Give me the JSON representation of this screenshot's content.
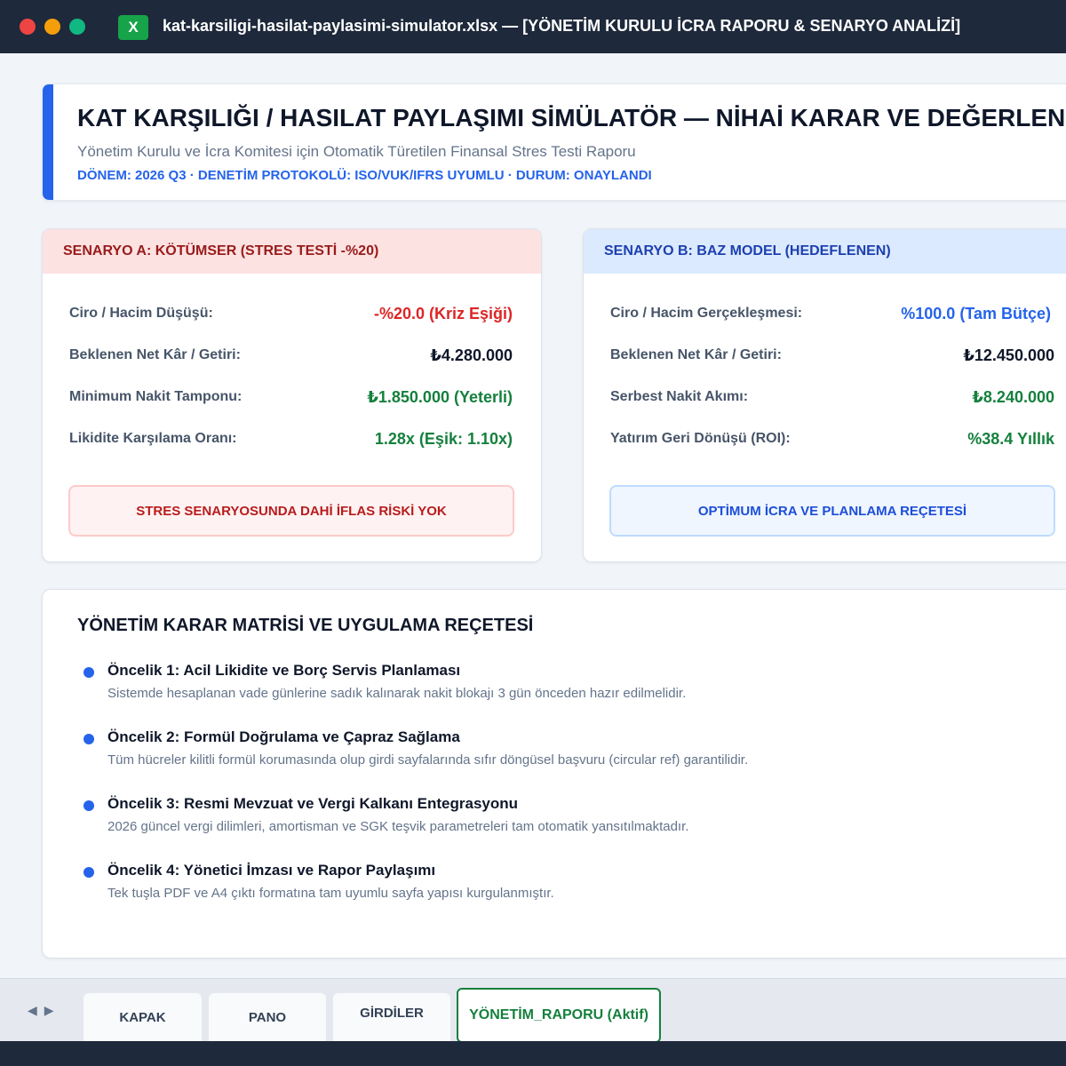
{
  "window": {
    "file_icon": "X",
    "title": "kat-karsiligi-hasilat-paylasimi-simulator.xlsx — [YÖNETİM KURULU İCRA RAPORU & SENARYO ANALİZİ]"
  },
  "header": {
    "title": "KAT KARŞILIĞI / HASILAT PAYLAŞIMI SİMÜLATÖR — NİHAİ KARAR VE DEĞERLENDİRME",
    "subtitle": "Yönetim Kurulu ve İcra Komitesi için Otomatik Türetilen Finansal Stres Testi Raporu",
    "meta": "DÖNEM: 2026 Q3 · DENETİM PROTOKOLÜ: ISO/VUK/IFRS UYUMLU · DURUM: ONAYLANDI"
  },
  "scenario_a": {
    "title": "SENARYO A: KÖTÜMSER (STRES TESTİ -%20)",
    "rows": [
      {
        "label": "Ciro / Hacim Düşüşü:",
        "value": "-%20.0 (Kriz Eşiği)"
      },
      {
        "label": "Beklenen Net Kâr / Getiri:",
        "value": "₺4.280.000"
      },
      {
        "label": "Minimum Nakit Tamponu:",
        "value": "₺1.850.000 (Yeterli)"
      },
      {
        "label": "Likidite Karşılama Oranı:",
        "value": "1.28x (Eşik: 1.10x)"
      }
    ],
    "button": "STRES SENARYOSUNDA DAHİ İFLAS RİSKİ YOK"
  },
  "scenario_b": {
    "title": "SENARYO B: BAZ MODEL (HEDEFLENEN)",
    "rows": [
      {
        "label": "Ciro / Hacim Gerçekleşmesi:",
        "value": "%100.0 (Tam Bütçe)"
      },
      {
        "label": "Beklenen Net Kâr / Getiri:",
        "value": "₺12.450.000"
      },
      {
        "label": "Serbest Nakit Akımı:",
        "value": "₺8.240.000"
      },
      {
        "label": "Yatırım Geri Dönüşü (ROI):",
        "value": "%38.4 Yıllık"
      }
    ],
    "button": "OPTİMUM İCRA VE PLANLAMA REÇETESİ"
  },
  "matrix": {
    "title": "YÖNETİM KARAR MATRİSİ VE UYGULAMA REÇETESİ",
    "items": [
      {
        "title": "Öncelik 1: Acil Likidite ve Borç Servis Planlaması",
        "desc": "Sistemde hesaplanan vade günlerine sadık kalınarak nakit blokajı 3 gün önceden hazır edilmelidir."
      },
      {
        "title": "Öncelik 2: Formül Doğrulama ve Çapraz Sağlama",
        "desc": "Tüm hücreler kilitli formül korumasında olup girdi sayfalarında sıfır döngüsel başvuru (circular ref) garantilidir."
      },
      {
        "title": "Öncelik 3: Resmi Mevzuat ve Vergi Kalkanı Entegrasyonu",
        "desc": "2026 güncel vergi dilimleri, amortisman ve SGK teşvik parametreleri tam otomatik yansıtılmaktadır."
      },
      {
        "title": "Öncelik 4: Yönetici İmzası ve Rapor Paylaşımı",
        "desc": "Tek tuşla PDF ve A4 çıktı formatına tam uyumlu sayfa yapısı kurgulanmıştır."
      }
    ]
  },
  "sheets": {
    "nav_prev": "◀",
    "nav_next": "▶",
    "tabs": [
      "KAPAK",
      "PANO",
      "GİRDİLER",
      "YÖNETİM_RAPORU (Aktif)"
    ]
  },
  "colors": {
    "accent": "#2563eb",
    "danger": "#dc2626",
    "success": "#15803d",
    "titlebar": "#1e293b",
    "excel": "#16a34a"
  },
  "icons": {
    "app": "excel-icon",
    "bullet": "bullet-dot-icon"
  }
}
